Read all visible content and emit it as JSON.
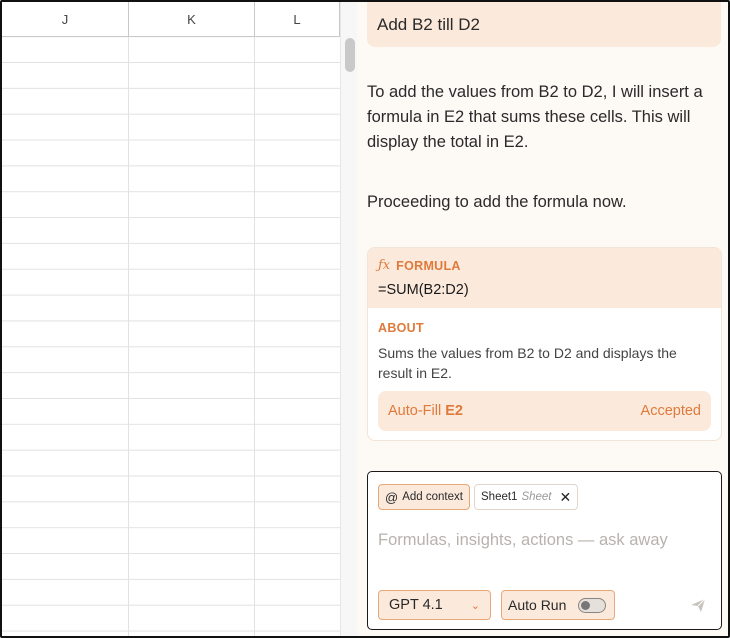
{
  "sheet": {
    "columns": [
      "J",
      "K",
      "L"
    ]
  },
  "chat": {
    "user_message": "Add B2 till D2",
    "assistant_paragraph_1": "To add the values from B2 to D2, I will insert a formula in E2 that sums these cells. This will display the total in E2.",
    "assistant_paragraph_2": "Proceeding to add the formula now.",
    "formula_card": {
      "label": "FORMULA",
      "formula": "=SUM(B2:D2)",
      "about_label": "ABOUT",
      "about_text": "Sums the values from B2 to D2 and displays the result in E2.",
      "autofill_prefix": "Auto-Fill",
      "autofill_cell": "E2",
      "status": "Accepted"
    }
  },
  "composer": {
    "add_context_label": "Add context",
    "context_chip_name": "Sheet1",
    "context_chip_type": "Sheet",
    "placeholder": "Formulas, insights, actions — ask away",
    "model": "GPT 4.1",
    "auto_run_label": "Auto Run",
    "auto_run_enabled": false
  },
  "colors": {
    "accent": "#e07a3a",
    "accent_bg": "#fbe9dc",
    "panel_bg": "#fdf9f5"
  },
  "icons": [
    "fx-icon",
    "at-icon",
    "close-icon",
    "chevron-down-icon",
    "send-icon"
  ]
}
